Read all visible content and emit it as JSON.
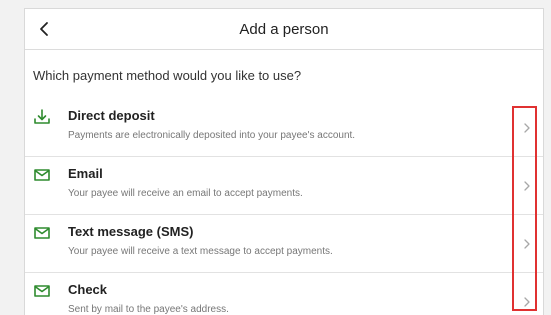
{
  "header": {
    "title": "Add a person",
    "back_icon": "chevron-left-icon"
  },
  "question": "Which payment method would you like to use?",
  "options": [
    {
      "icon": "download-icon",
      "title": "Direct deposit",
      "description": "Payments are electronically deposited into your payee's account."
    },
    {
      "icon": "envelope-icon",
      "title": "Email",
      "description": "Your payee will receive an email to accept payments."
    },
    {
      "icon": "envelope-icon",
      "title": "Text message (SMS)",
      "description": "Your payee will receive a text message to accept payments."
    },
    {
      "icon": "envelope-icon",
      "title": "Check",
      "description": "Sent by mail to the payee's address."
    }
  ],
  "colors": {
    "accent_green": "#2e8b2e",
    "highlight_red": "#e03131",
    "chevron_gray": "#a8a8a8"
  }
}
